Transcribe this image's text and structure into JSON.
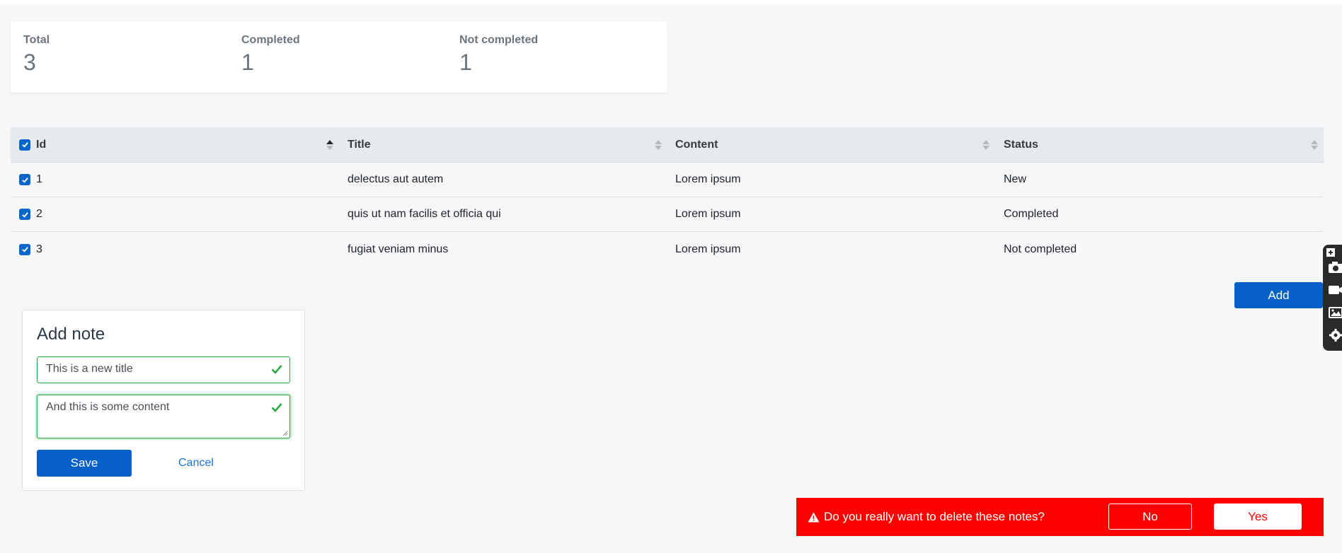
{
  "stats": [
    {
      "label": "Total",
      "value": "3"
    },
    {
      "label": "Completed",
      "value": "1"
    },
    {
      "label": "Not completed",
      "value": "1"
    }
  ],
  "table": {
    "headers": [
      "Id",
      "Title",
      "Content",
      "Status"
    ],
    "rows": [
      {
        "id": "1",
        "title": "delectus aut autem",
        "content": "Lorem ipsum",
        "status": "New"
      },
      {
        "id": "2",
        "title": "quis ut nam facilis et officia qui",
        "content": "Lorem ipsum",
        "status": "Completed"
      },
      {
        "id": "3",
        "title": "fugiat veniam minus",
        "content": "Lorem ipsum",
        "status": "Not completed"
      }
    ]
  },
  "add_label": "Add",
  "form": {
    "heading": "Add note",
    "title_value": "This is a new title",
    "content_value": "And this is some content",
    "save_label": "Save",
    "cancel_label": "Cancel"
  },
  "confirm": {
    "message": "Do you really want to delete these notes?",
    "no_label": "No",
    "yes_label": "Yes"
  },
  "colors": {
    "primary": "#0660c8",
    "valid": "#28a745",
    "danger": "#ff0000"
  },
  "icons": [
    "check-icon",
    "sort-icon",
    "warning-icon",
    "camera-icon",
    "video-icon",
    "image-icon",
    "gear-icon",
    "expand-icon"
  ]
}
